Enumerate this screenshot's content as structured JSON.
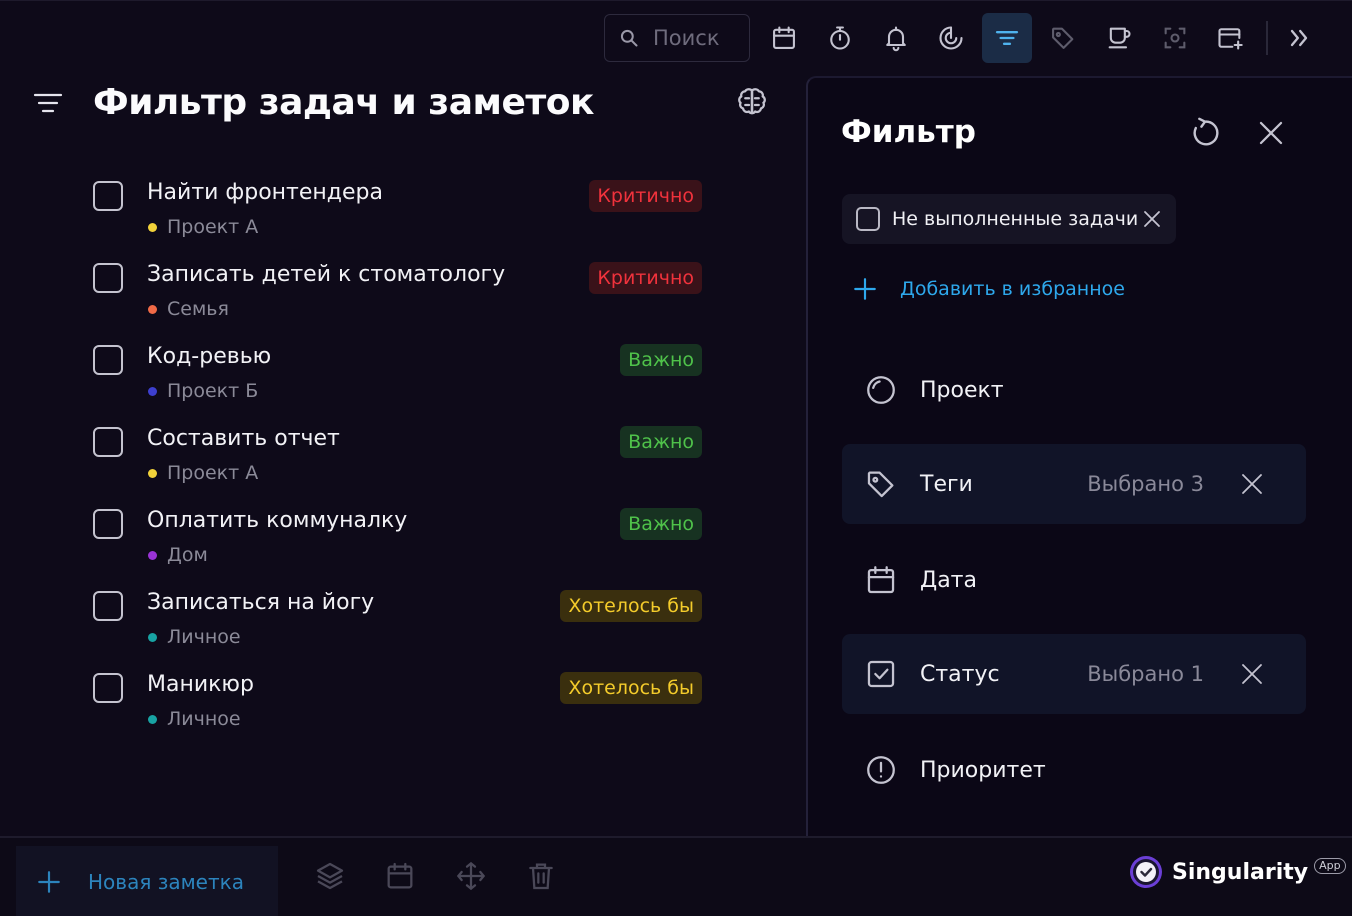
{
  "toolbar": {
    "search_placeholder": "Поиск",
    "icons": [
      "calendar-icon",
      "timer-icon",
      "bell-icon",
      "habit-icon",
      "filter-icon",
      "tag-icon",
      "coffee-icon",
      "focus-icon",
      "new-window-icon",
      "expand-right-icon"
    ],
    "active_icon": "filter-icon",
    "active_color": "#1b2c46"
  },
  "main": {
    "title": "Фильтр задач и заметок",
    "tasks": [
      {
        "title": "Найти фронтендера",
        "project": "Проект А",
        "project_color": "#f2d23a",
        "priority": "Критично",
        "priority_fg": "#f0323c",
        "priority_bg": "#3a1219"
      },
      {
        "title": "Записать детей к стоматологу",
        "project": "Семья",
        "project_color": "#f06a47",
        "priority": "Критично",
        "priority_fg": "#f0323c",
        "priority_bg": "#3a1219"
      },
      {
        "title": "Код-ревью",
        "project": "Проект Б",
        "project_color": "#3d3fcf",
        "priority": "Важно",
        "priority_fg": "#4fc24a",
        "priority_bg": "#173221"
      },
      {
        "title": "Составить отчет",
        "project": "Проект А",
        "project_color": "#f2d23a",
        "priority": "Важно",
        "priority_fg": "#4fc24a",
        "priority_bg": "#173221"
      },
      {
        "title": "Оплатить коммуналку",
        "project": "Дом",
        "project_color": "#9a33d6",
        "priority": "Важно",
        "priority_fg": "#4fc24a",
        "priority_bg": "#173221"
      },
      {
        "title": "Записаться на йогу",
        "project": "Личное",
        "project_color": "#18a3a3",
        "priority": "Хотелось бы",
        "priority_fg": "#f4cc2b",
        "priority_bg": "#3a2f0e"
      },
      {
        "title": "Маникюр",
        "project": "Личное",
        "project_color": "#18a3a3",
        "priority": "Хотелось бы",
        "priority_fg": "#f4cc2b",
        "priority_bg": "#3a2f0e"
      }
    ]
  },
  "filter": {
    "title": "Фильтр",
    "chip_label": "Не выполненные задачи",
    "add_favorite": "Добавить в избранное",
    "accent": "#2ea8ec",
    "rows": [
      {
        "label": "Проект",
        "value": "",
        "icon": "project-circle-icon",
        "selected": false
      },
      {
        "label": "Теги",
        "value": "Выбрано 3",
        "icon": "tag-icon",
        "selected": true
      },
      {
        "label": "Дата",
        "value": "",
        "icon": "calendar-icon",
        "selected": false
      },
      {
        "label": "Статус",
        "value": "Выбрано 1",
        "icon": "checkbox-icon",
        "selected": true
      },
      {
        "label": "Приоритет",
        "value": "",
        "icon": "priority-icon",
        "selected": false
      }
    ]
  },
  "bottom": {
    "new_note": "Новая заметка",
    "icons": [
      "layers-icon",
      "calendar-icon",
      "move-icon",
      "trash-icon"
    ]
  },
  "brand": {
    "name": "Singularity",
    "tag": "App"
  }
}
